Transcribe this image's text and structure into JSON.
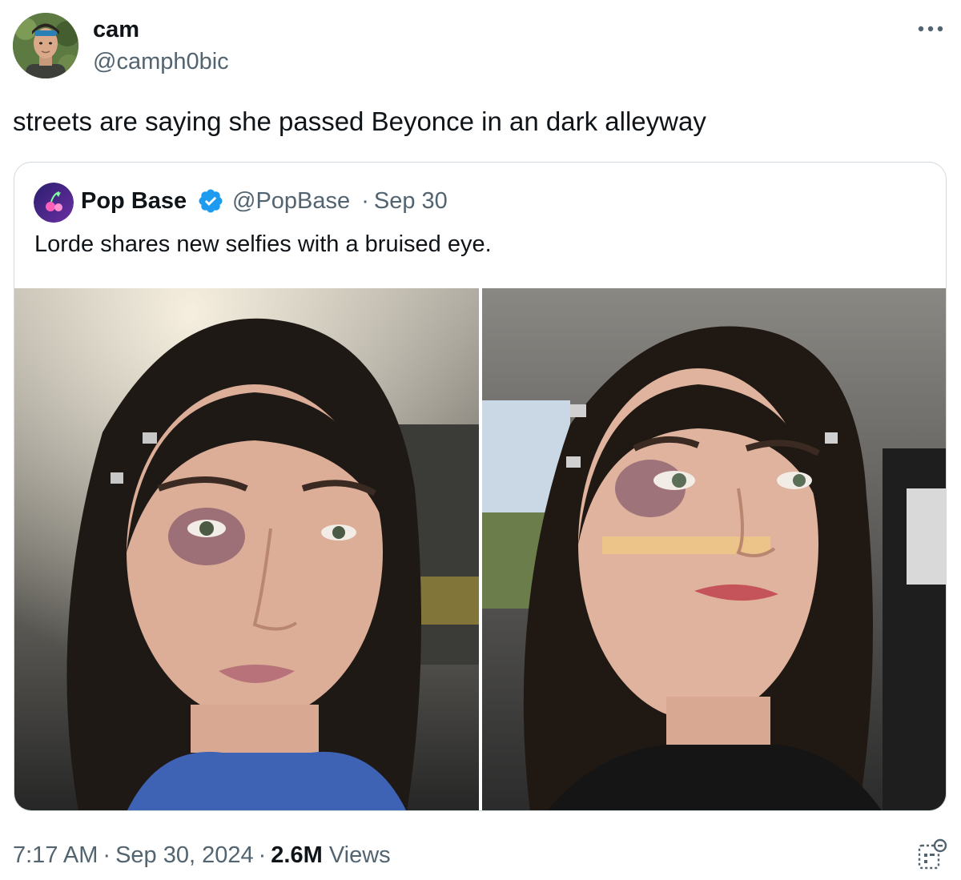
{
  "author": {
    "display_name": "cam",
    "handle": "@camph0bic",
    "avatar_icon": "user-avatar-photo"
  },
  "tweet": {
    "text": "streets are saying she passed Beyonce in an dark alleyway",
    "more_icon": "more-horizontal-icon"
  },
  "quoted_tweet": {
    "display_name": "Pop Base",
    "verified": true,
    "handle": "@PopBase",
    "separator": "·",
    "date": "Sep 30",
    "text": "Lorde shares new selfies with a bruised eye.",
    "verified_color": "#1d9bf0",
    "photos": [
      {
        "icon": "selfie-photo-left"
      },
      {
        "icon": "selfie-photo-right"
      }
    ]
  },
  "footer": {
    "time": "7:17 AM",
    "separator": "·",
    "date": "Sep 30, 2024",
    "views_count": "2.6M",
    "views_label": "Views",
    "analytics_icon": "analytics-icon"
  }
}
